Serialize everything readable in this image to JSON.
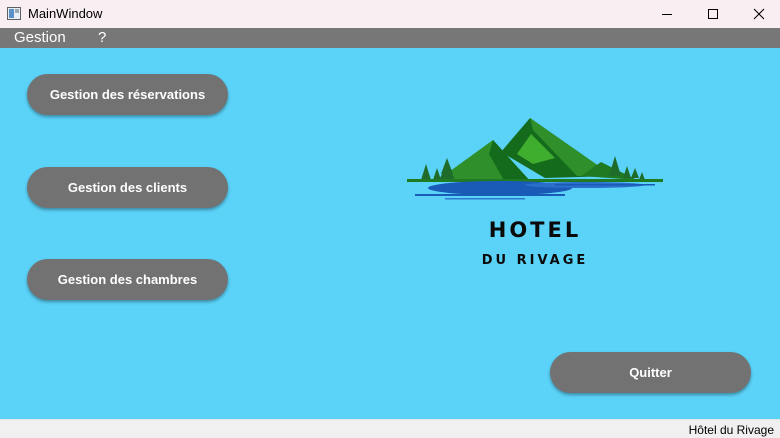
{
  "window": {
    "title": "MainWindow"
  },
  "menubar": {
    "items": [
      {
        "label": "Gestion"
      },
      {
        "label": "?"
      }
    ]
  },
  "buttons": {
    "reservations": "Gestion des réservations",
    "clients": "Gestion des clients",
    "chambres": "Gestion des chambres",
    "quit": "Quitter"
  },
  "logo": {
    "title": "HOTEL",
    "subtitle": "DU RIVAGE"
  },
  "statusbar": {
    "text": "Hôtel du Rivage"
  },
  "colors": {
    "background": "#5bd3f9",
    "button": "#727272",
    "menubar": "#777777",
    "mountain_dark": "#146b1c",
    "mountain_light": "#2f8f2a",
    "water": "#1a5bb8"
  },
  "icons": {
    "app": "app-window-icon",
    "minimize": "minimize-icon",
    "maximize": "maximize-icon",
    "close": "close-icon",
    "logo": "mountain-lake-logo-icon"
  }
}
